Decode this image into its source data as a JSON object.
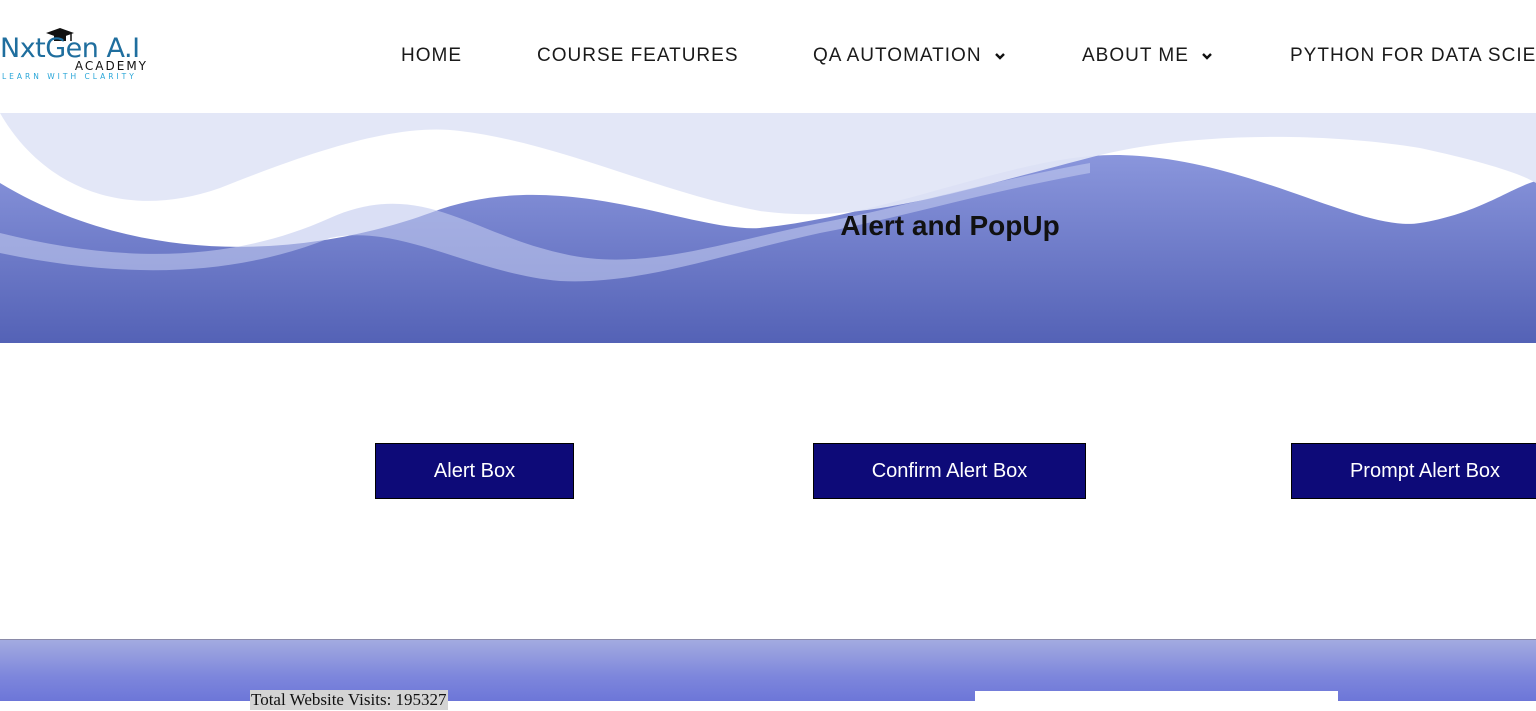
{
  "header": {
    "logo": {
      "name": "NxtGen A.I",
      "sub": "ACADEMY",
      "tagline": "LEARN WITH CLARITY",
      "icon": "graduation-cap-icon"
    },
    "nav": [
      {
        "label": "HOME"
      },
      {
        "label": "COURSE FEATURES"
      },
      {
        "label": "QA AUTOMATION",
        "has_dropdown": true,
        "icon": "chevron-down-icon"
      },
      {
        "label": "ABOUT ME",
        "has_dropdown": true,
        "icon": "chevron-down-icon"
      },
      {
        "label": "PYTHON FOR DATA SCIE"
      }
    ]
  },
  "hero": {
    "title": "Alert and PopUp"
  },
  "buttons": {
    "alert": "Alert Box",
    "confirm": "Confirm Alert Box",
    "prompt": "Prompt Alert Box"
  },
  "footer": {
    "visits_text": "Total Website Visits: 195327"
  },
  "colors": {
    "button_bg": "#0d0a78",
    "hero_wave": "#5a68bd",
    "brand_text": "#1f6e9e",
    "tagline": "#2aa6d8"
  }
}
